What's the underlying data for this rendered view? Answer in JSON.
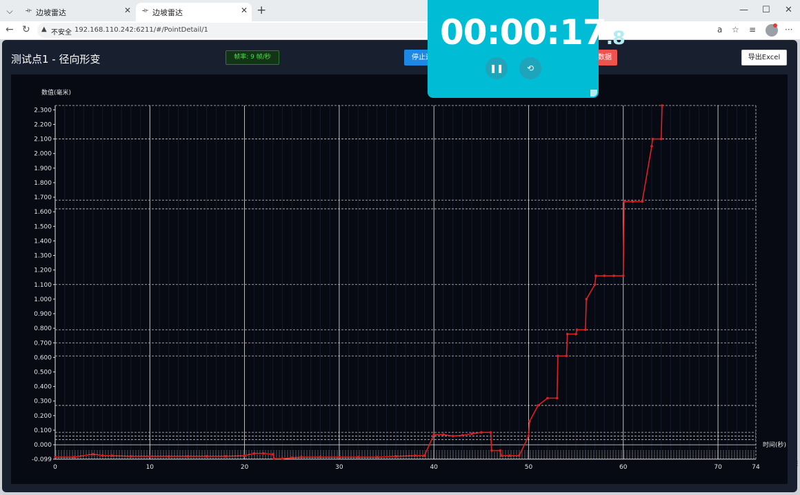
{
  "browser": {
    "tabs": [
      {
        "title": "边坡雷达",
        "favicon": "radar-icon",
        "active": false
      },
      {
        "title": "边坡雷达",
        "favicon": "radar-icon",
        "active": true
      }
    ],
    "new_tab": "+",
    "address": {
      "insecure_label": "不安全",
      "url": "192.168.110.242:6211/#/PointDetail/1"
    }
  },
  "header": {
    "title": "测试点1 - 径向形变",
    "fps_label": "帧率: 9 帧/秒",
    "stop_label": "停止运",
    "clear_label": "数据",
    "export_label": "导出Excel"
  },
  "stopwatch": {
    "time_main": "00:00:17",
    "time_frac": ".8",
    "pause_icon": "pause-icon",
    "reset_icon": "reset-icon",
    "bg_color": "#00bcd4"
  },
  "colors": {
    "accent_blue": "#1e88e5",
    "danger_red": "#ef5350",
    "fps_green": "#48e048",
    "series_red": "#e02020",
    "panel_bg": "#070913"
  },
  "chart_data": {
    "type": "line",
    "title": "",
    "xlabel": "时间(秒)",
    "ylabel": "数值(毫米)",
    "xlim": [
      0,
      74
    ],
    "ylim": [
      -0.099,
      2.33
    ],
    "x_ticks": [
      0,
      10,
      20,
      30,
      40,
      50,
      60,
      70,
      74
    ],
    "y_ticks": [
      "-0.099",
      "0.000",
      "0.100",
      "0.200",
      "0.300",
      "0.400",
      "0.500",
      "0.600",
      "0.700",
      "0.800",
      "0.900",
      "1.000",
      "1.100",
      "1.200",
      "1.300",
      "1.400",
      "1.500",
      "1.600",
      "1.700",
      "1.800",
      "1.900",
      "2.000",
      "2.100",
      "2.200",
      "2.300"
    ],
    "grid": true,
    "legend": "none",
    "series": [
      {
        "x": [
          0,
          2,
          4,
          5,
          6,
          8,
          10,
          12,
          14,
          16,
          18,
          20,
          21,
          22,
          23,
          23.1,
          24,
          25,
          26,
          28,
          30,
          32,
          34,
          36,
          38,
          39,
          40,
          41,
          42,
          43,
          44,
          45,
          46,
          46.1,
          47,
          47.1,
          48,
          49,
          50,
          50.1,
          51,
          52,
          53,
          53.1,
          54,
          54.1,
          55,
          55.1,
          56,
          56.1,
          57,
          57.1,
          58,
          59,
          60,
          60.1,
          61,
          62,
          63,
          63.1,
          64,
          64.1
        ],
        "y": [
          -0.085,
          -0.085,
          -0.065,
          -0.075,
          -0.075,
          -0.08,
          -0.08,
          -0.08,
          -0.08,
          -0.08,
          -0.08,
          -0.075,
          -0.06,
          -0.06,
          -0.065,
          -0.095,
          -0.095,
          -0.09,
          -0.085,
          -0.085,
          -0.085,
          -0.085,
          -0.085,
          -0.08,
          -0.075,
          -0.075,
          0.07,
          0.07,
          0.06,
          0.065,
          0.075,
          0.085,
          0.085,
          -0.04,
          -0.04,
          -0.075,
          -0.075,
          -0.075,
          0.06,
          0.16,
          0.27,
          0.32,
          0.32,
          0.61,
          0.61,
          0.76,
          0.76,
          0.79,
          0.79,
          1.0,
          1.1,
          1.16,
          1.16,
          1.16,
          1.16,
          1.67,
          1.67,
          1.67,
          2.05,
          2.1,
          2.1,
          2.33
        ],
        "color": "#e02020"
      }
    ],
    "reference_lines_y": [
      0.085,
      0.06,
      0.035,
      0.27,
      0.61,
      0.7,
      0.79,
      1.1,
      1.62,
      1.68,
      2.1,
      2.33
    ]
  },
  "right_edge_icon": "resize-handle-icon"
}
